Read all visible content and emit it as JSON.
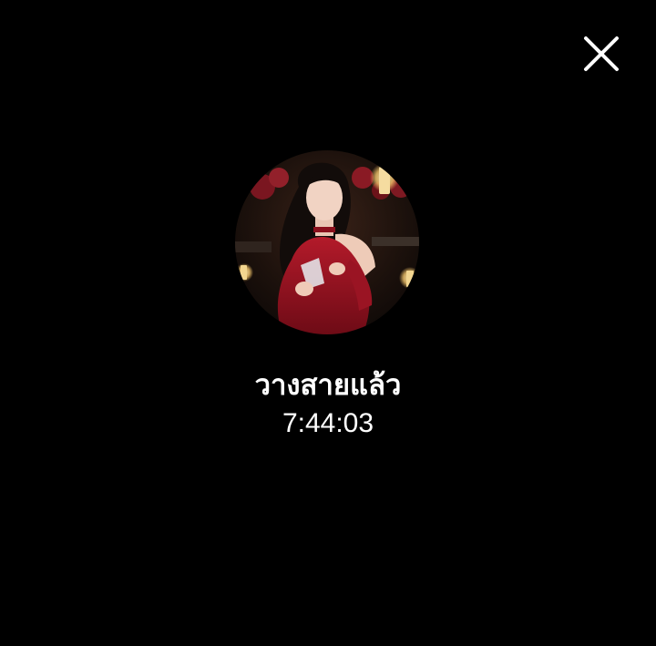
{
  "call": {
    "status": "วางสายแล้ว",
    "duration": "7:44:03"
  },
  "icons": {
    "close": "close-icon"
  },
  "colors": {
    "background": "#000000",
    "text": "#ffffff"
  }
}
